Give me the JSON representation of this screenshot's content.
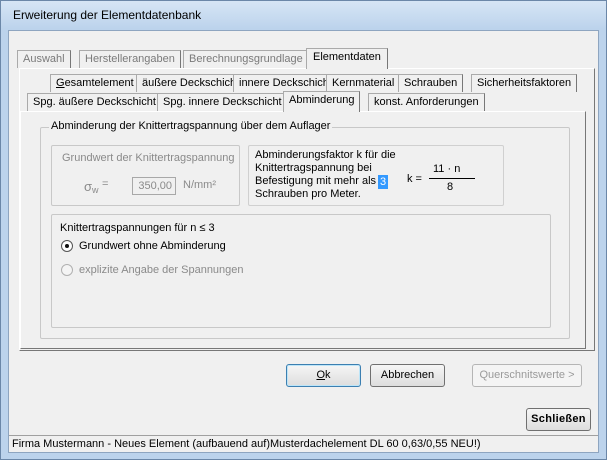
{
  "window": {
    "title": "Erweiterung der Elementdatenbank"
  },
  "tabs_top": [
    {
      "label": "Auswahl",
      "state": "disabled"
    },
    {
      "label": "Herstellerangaben",
      "state": "disabled"
    },
    {
      "label": "Berechnungsgrundlage",
      "state": "disabled"
    },
    {
      "label": "Elementdaten",
      "state": "active"
    }
  ],
  "tabs_row2": [
    {
      "label": "Gesamtelement"
    },
    {
      "label": "äußere Deckschicht"
    },
    {
      "label": "innere Deckschicht"
    },
    {
      "label": "Kernmaterial"
    },
    {
      "label": "Schrauben"
    },
    {
      "label": "Sicherheitsfaktoren"
    }
  ],
  "tabs_row3": [
    {
      "label": "Spg. äußere Deckschicht"
    },
    {
      "label": "Spg. innere Deckschicht"
    },
    {
      "label": "Abminderung",
      "state": "active"
    },
    {
      "label": "konst. Anforderungen"
    }
  ],
  "main_group": {
    "title": "Abminderung der Knittertragspannung über dem Auflager"
  },
  "grundwert_group": {
    "title": "Grundwert der Knittertragspannung",
    "symbol": "σ",
    "subscript": "w",
    "equals": "=",
    "value": "350,00",
    "unit": "N/mm²"
  },
  "factor_box": {
    "line1": "Abminderungsfaktor k für die",
    "line2": "Knittertragspannung bei",
    "line3": "Befestigung mit mehr als",
    "line4": "Schrauben pro Meter.",
    "n_value": "3",
    "k_label": "k =",
    "numerator": "11 · n",
    "denominator": "8"
  },
  "options_group": {
    "title": "Knittertragspannungen für n ≤ 3",
    "option1": "Grundwert ohne Abminderung",
    "option2": "explizite Angabe der Spannungen",
    "selected": "option1"
  },
  "buttons": {
    "ok": "Ok",
    "cancel": "Abbrechen",
    "querschnitt": "Querschnitswerte >",
    "close": "Schließen"
  },
  "status": {
    "text": "Firma Mustermann - Neues Element  (aufbauend auf)Musterdachelement DL 60 0,63/0,55 NEU!)"
  }
}
